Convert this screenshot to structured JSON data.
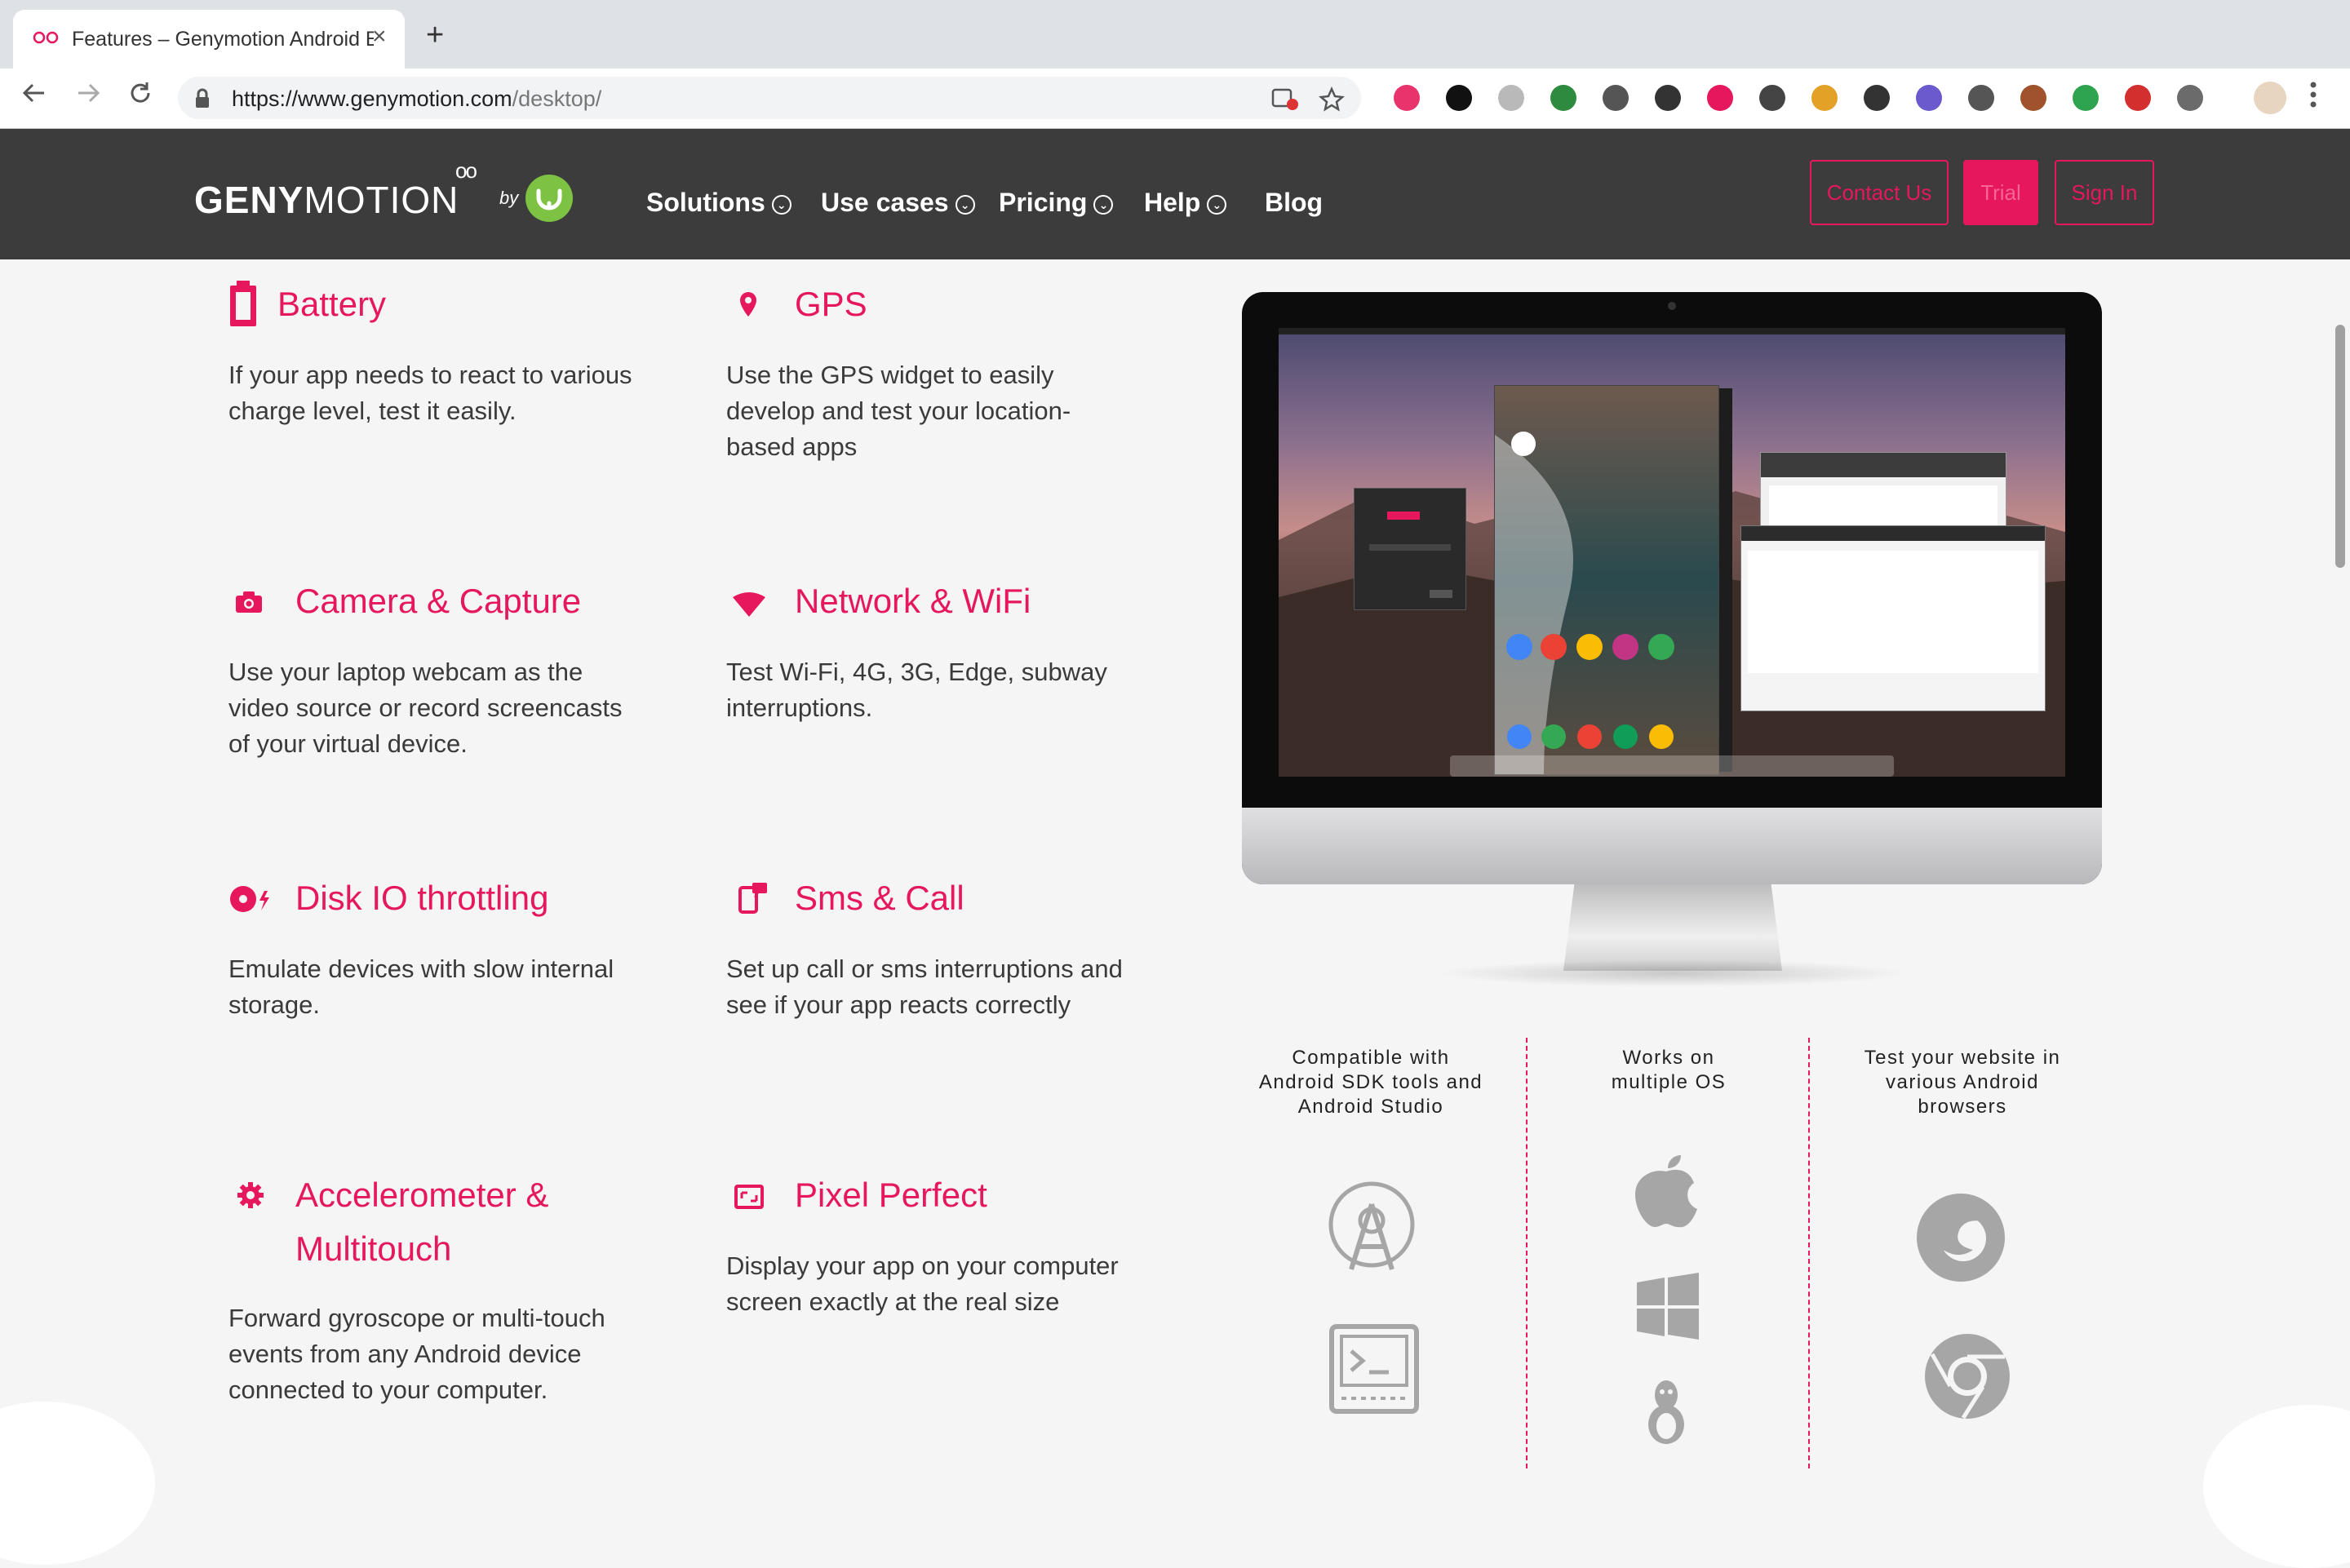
{
  "browser": {
    "tab_title": "Features – Genymotion Android Emulator",
    "close_glyph": "×",
    "new_tab_glyph": "+",
    "url_host": "https://www.genymotion.com",
    "url_path": "/desktop/",
    "extension_colors": [
      "#e8336d",
      "#111111",
      "#b9b9b9",
      "#2d8a3e",
      "#555555",
      "#333333",
      "#e6175c",
      "#444444",
      "#e4a128",
      "#333333",
      "#6a5acd",
      "#555555",
      "#a0522d",
      "#2ea44f",
      "#d32f2f",
      "#6b6b6b"
    ]
  },
  "header": {
    "logo_bold": "GENY",
    "logo_light": "MOTION",
    "logo_oo": "oo",
    "by": "by",
    "nav": [
      {
        "label": "Solutions",
        "dropdown": true
      },
      {
        "label": "Use cases",
        "dropdown": true
      },
      {
        "label": "Pricing",
        "dropdown": true
      },
      {
        "label": "Help",
        "dropdown": true
      },
      {
        "label": "Blog",
        "dropdown": false
      }
    ],
    "contact": "Contact Us",
    "trial": "Trial",
    "signin": "Sign In",
    "accent": "#e6175c"
  },
  "features": [
    {
      "title": "Battery",
      "icon": "battery-icon",
      "text": "If your app needs to react to various charge level, test it easily."
    },
    {
      "title": "GPS",
      "icon": "location-pin-icon",
      "text": "Use the GPS widget to easily develop and test your location-based apps"
    },
    {
      "title": "Camera & Capture",
      "icon": "camera-icon",
      "text": "Use your laptop webcam as the video source or record screencasts of your virtual device."
    },
    {
      "title": "Network & WiFi",
      "icon": "wifi-icon",
      "text": "Test Wi-Fi, 4G, 3G, Edge, subway interruptions."
    },
    {
      "title": "Disk IO throttling",
      "icon": "disk-icon",
      "text": "Emulate devices with slow internal storage."
    },
    {
      "title": "Sms & Call",
      "icon": "sms-call-icon",
      "text": "Set up call or sms interruptions and see if your app reacts correctly"
    },
    {
      "title": "Accelerometer & Multitouch",
      "icon": "gear-icon",
      "text": "Forward gyroscope or multi-touch events from any Android device connected to your computer."
    },
    {
      "title": "Pixel Perfect",
      "icon": "pixel-perfect-icon",
      "text": "Display your app on your computer screen exactly at the real size"
    }
  ],
  "compat": [
    {
      "text": "Compatible with Android SDK tools and Android Studio",
      "icons": [
        "android-studio-icon",
        "terminal-icon"
      ]
    },
    {
      "text": "Works on multiple OS",
      "icons": [
        "apple-icon",
        "windows-icon",
        "linux-icon"
      ]
    },
    {
      "text": "Test your website in various Android browsers",
      "icons": [
        "firefox-icon",
        "chrome-icon"
      ]
    }
  ]
}
